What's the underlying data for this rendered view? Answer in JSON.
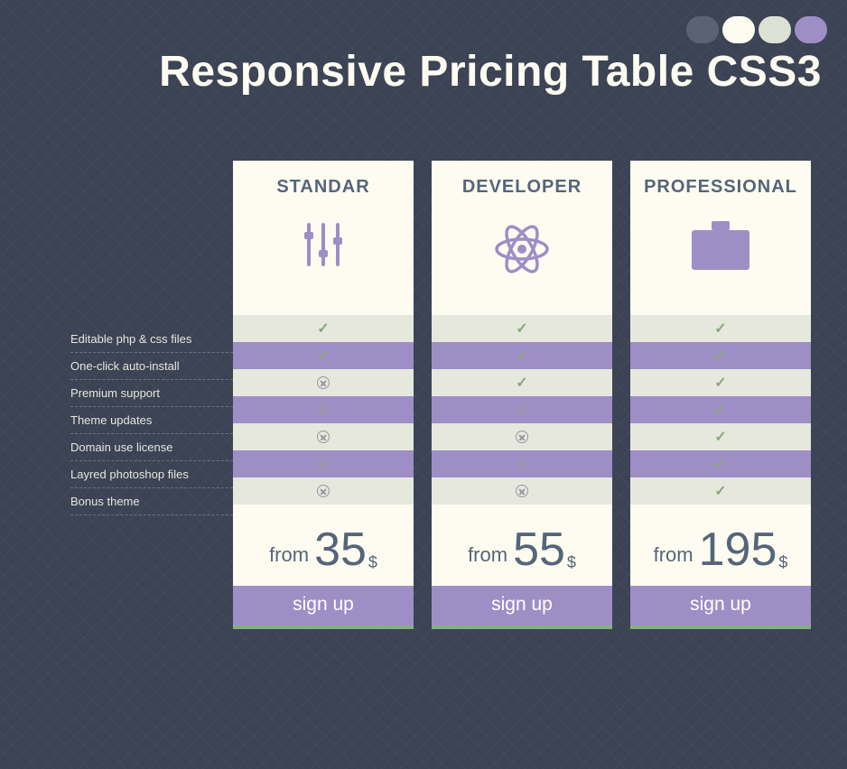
{
  "title": "Responsive Pricing Table CSS3",
  "features": [
    "Editable php & css files",
    "One-click auto-install",
    "Premium support",
    "Theme updates",
    "Domain use license",
    "Layred photoshop files",
    "Bonus theme"
  ],
  "price_prefix": "from",
  "currency": "$",
  "signup_label": "sign up",
  "plans": [
    {
      "name": "STANDAR",
      "icon": "sliders-icon",
      "price": "35",
      "checks": [
        true,
        true,
        false,
        false,
        false,
        false,
        false
      ]
    },
    {
      "name": "DEVELOPER",
      "icon": "atom-icon",
      "price": "55",
      "checks": [
        true,
        true,
        true,
        false,
        false,
        false,
        false
      ]
    },
    {
      "name": "PROFESSIONAL",
      "icon": "briefcase-icon",
      "price": "195",
      "checks": [
        true,
        true,
        true,
        true,
        true,
        true,
        true
      ]
    }
  ],
  "colors": {
    "bg": "#3b4355",
    "card": "#fefcf1",
    "accent": "#9e8ec6",
    "text_dark": "#55657a",
    "ok": "#89a77c"
  }
}
